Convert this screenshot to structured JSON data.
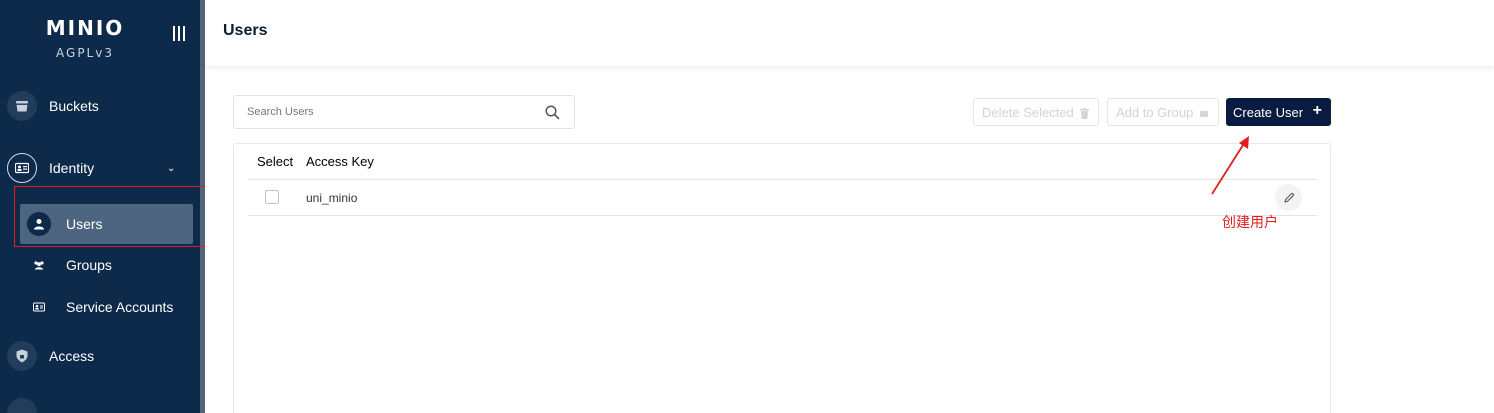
{
  "sidebar": {
    "logo": "MINIO",
    "license": "AGPLv3",
    "items": {
      "buckets": {
        "label": "Buckets",
        "icon": "bucket-icon"
      },
      "identity": {
        "label": "Identity",
        "icon": "id-card-icon",
        "expanded": true
      },
      "users": {
        "label": "Users",
        "icon": "user-icon",
        "active": true
      },
      "groups": {
        "label": "Groups",
        "icon": "group-icon"
      },
      "service_accounts": {
        "label": "Service Accounts",
        "icon": "service-account-icon"
      },
      "access": {
        "label": "Access",
        "icon": "shield-icon"
      }
    }
  },
  "header": {
    "title": "Users"
  },
  "toolbar": {
    "search_placeholder": "Search Users",
    "delete_selected": "Delete Selected",
    "add_to_group": "Add to Group",
    "create_user": "Create User"
  },
  "table": {
    "columns": [
      "Select",
      "Access Key"
    ],
    "rows": [
      {
        "access_key": "uni_minio",
        "selected": false
      }
    ]
  },
  "annotation": {
    "text": "创建用户",
    "color": "#e02020"
  },
  "colors": {
    "sidebar_bg": "#0d2a4b",
    "active_item_bg": "#4d6580",
    "primary_button": "#081c42",
    "annotation_red": "#e02020"
  }
}
